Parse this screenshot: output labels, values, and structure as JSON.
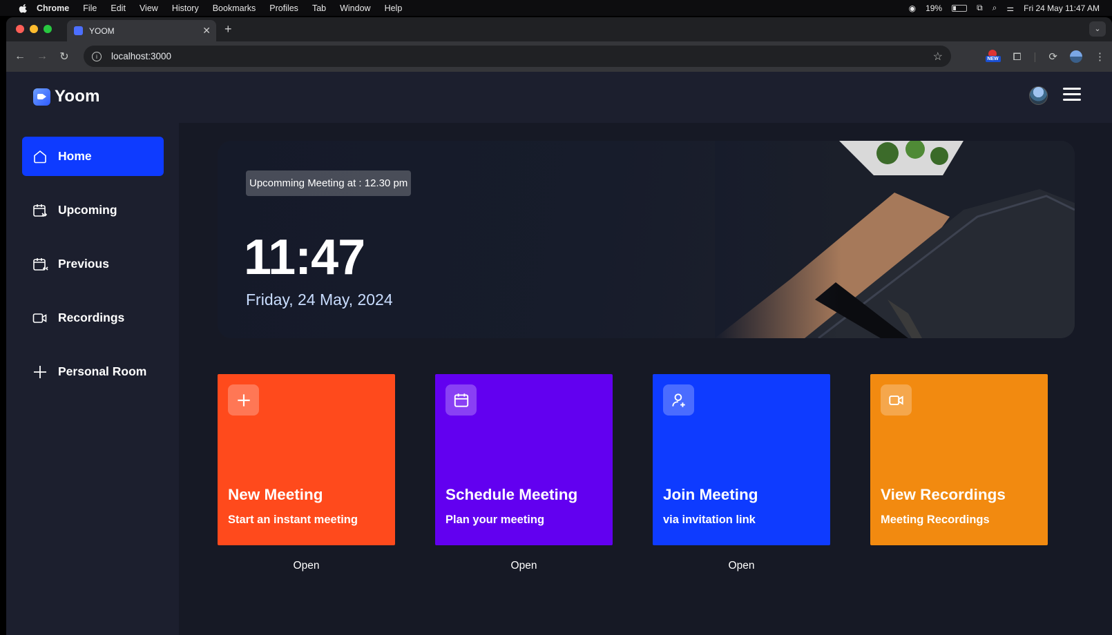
{
  "menubar": {
    "items": [
      "Chrome",
      "File",
      "Edit",
      "View",
      "History",
      "Bookmarks",
      "Profiles",
      "Tab",
      "Window",
      "Help"
    ],
    "battery": "19%",
    "datetime": "Fri 24 May  11:47 AM"
  },
  "browser": {
    "tab_title": "YOOM",
    "url": "localhost:3000",
    "extension_badge": "NEW"
  },
  "app": {
    "brand": "Yoom",
    "sidebar": [
      {
        "label": "Home",
        "icon": "home-icon",
        "active": true
      },
      {
        "label": "Upcoming",
        "icon": "calendar-upcoming-icon",
        "active": false
      },
      {
        "label": "Previous",
        "icon": "calendar-previous-icon",
        "active": false
      },
      {
        "label": "Recordings",
        "icon": "video-icon",
        "active": false
      },
      {
        "label": "Personal Room",
        "icon": "plus-icon",
        "active": false
      }
    ],
    "hero": {
      "badge": "Upcomming Meeting at : 12.30 pm",
      "time": "11:47",
      "date": "Friday, 24 May, 2024"
    },
    "cards": [
      {
        "title": "New Meeting",
        "subtitle": "Start an instant meeting",
        "icon": "plus-icon",
        "color": "#ff4a1c",
        "open": "Open"
      },
      {
        "title": "Schedule Meeting",
        "subtitle": "Plan your meeting",
        "icon": "calendar-icon",
        "color": "#6200f0",
        "open": "Open"
      },
      {
        "title": "Join Meeting",
        "subtitle": "via invitation link",
        "icon": "user-plus-icon",
        "color": "#0e3bff",
        "open": "Open"
      },
      {
        "title": "View Recordings",
        "subtitle": "Meeting Recordings",
        "icon": "video-icon",
        "color": "#f28a10",
        "open": ""
      }
    ],
    "colors": {
      "background": "#1c1f2e",
      "main": "#161925",
      "accent": "#0e3bff"
    }
  }
}
